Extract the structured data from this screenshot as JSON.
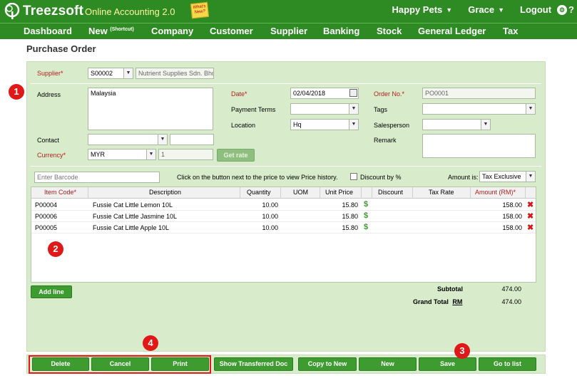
{
  "topbar": {
    "logo_text": "Treezsoft",
    "app_name": "Online Accounting 2.0",
    "whats_new": "What's New?",
    "company": "Happy Pets",
    "user": "Grace",
    "logout": "Logout",
    "help": "?"
  },
  "menu": {
    "dashboard": "Dashboard",
    "new": "New",
    "new_sup": "(Shortcut)",
    "company": "Company",
    "customer": "Customer",
    "supplier": "Supplier",
    "banking": "Banking",
    "stock": "Stock",
    "general_ledger": "General Ledger",
    "tax": "Tax"
  },
  "page_title": "Purchase Order",
  "form": {
    "supplier_label": "Supplier",
    "supplier_code": "S00002",
    "supplier_name": "Nutrient Supplies Sdn. Bhd",
    "address_label": "Address",
    "address_value": "Malaysia",
    "contact_label": "Contact",
    "currency_label": "Currency",
    "currency_value": "MYR",
    "rate_value": "1",
    "get_rate": "Get rate",
    "date_label": "Date",
    "date_value": "02/04/2018",
    "payment_terms_label": "Payment Terms",
    "location_label": "Location",
    "location_value": "Hq",
    "order_no_label": "Order No.",
    "order_no_value": "PO0001",
    "tags_label": "Tags",
    "salesperson_label": "Salesperson",
    "remark_label": "Remark",
    "required_mark": "*"
  },
  "toolbar": {
    "barcode_placeholder": "Enter Barcode",
    "hint": "Click on the button next to the price to view Price history.",
    "discount_by_pct": "Discount by %",
    "amount_is_label": "Amount is:",
    "amount_is_value": "Tax Exclusive"
  },
  "table": {
    "headers": {
      "item_code": "Item Code",
      "description": "Description",
      "quantity": "Quantity",
      "uom": "UOM",
      "unit_price": "Unit Price",
      "discount": "Discount",
      "tax_rate": "Tax Rate",
      "amount": "Amount (RM)"
    },
    "rows": [
      {
        "code": "P00004",
        "description": "Fussie Cat Little Lemon 10L",
        "quantity": "10.00",
        "uom": "",
        "unit_price": "15.80",
        "discount": "",
        "tax_rate": "",
        "amount": "158.00"
      },
      {
        "code": "P00006",
        "description": "Fussie Cat Little Jasmine 10L",
        "quantity": "10.00",
        "uom": "",
        "unit_price": "15.80",
        "discount": "",
        "tax_rate": "",
        "amount": "158.00"
      },
      {
        "code": "P00005",
        "description": "Fussie Cat Little Apple 10L",
        "quantity": "10.00",
        "uom": "",
        "unit_price": "15.80",
        "discount": "",
        "tax_rate": "",
        "amount": "158.00"
      }
    ],
    "price_icon": "$",
    "delete_icon": "✖"
  },
  "add_line": "Add line",
  "totals": {
    "subtotal_label": "Subtotal",
    "subtotal_value": "474.00",
    "grand_total_label": "Grand Total",
    "grand_total_currency": "RM",
    "grand_total_value": "474.00"
  },
  "actions": {
    "delete": "Delete",
    "cancel": "Cancel",
    "print": "Print",
    "show_transferred": "Show Transferred Doc",
    "copy_to_new": "Copy to New",
    "new": "New",
    "save": "Save",
    "go_to_list": "Go to list"
  },
  "markers": {
    "m1": "1",
    "m2": "2",
    "m3": "3",
    "m4": "4"
  },
  "colors": {
    "brand_green": "#2e8b23",
    "panel_bg": "#d8eccb",
    "button_green": "#3d9b2f",
    "marker_red": "#e01818",
    "required_red": "#b02020"
  }
}
